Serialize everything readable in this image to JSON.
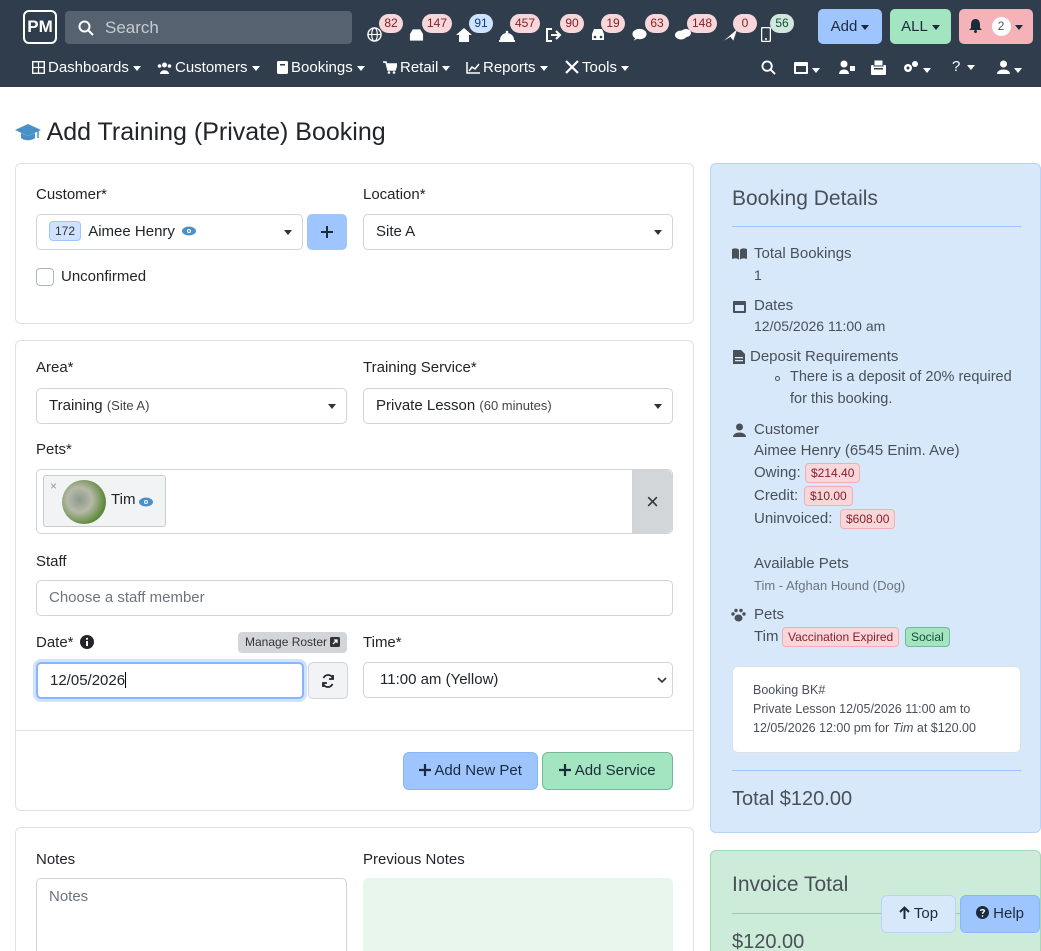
{
  "app": {
    "logo": "PM"
  },
  "search": {
    "placeholder": "Search"
  },
  "counters": [
    {
      "icon": "globe-icon",
      "value": "82",
      "tone": "red"
    },
    {
      "icon": "inbox-icon",
      "value": "147",
      "tone": "red"
    },
    {
      "icon": "home-icon",
      "value": "91",
      "tone": "blue"
    },
    {
      "icon": "bell-service-icon",
      "value": "457",
      "tone": "red"
    },
    {
      "icon": "sign-out-icon",
      "value": "90",
      "tone": "red"
    },
    {
      "icon": "car-icon",
      "value": "19",
      "tone": "red"
    },
    {
      "icon": "chat-icon",
      "value": "63",
      "tone": "red"
    },
    {
      "icon": "comments-icon",
      "value": "148",
      "tone": "red"
    },
    {
      "icon": "plane-icon",
      "value": "0",
      "tone": "red"
    },
    {
      "icon": "mobile-icon",
      "value": "56",
      "tone": "green"
    }
  ],
  "toolbar": {
    "add_label": "Add",
    "all_label": "ALL",
    "notif_count": "2"
  },
  "nav": {
    "dashboards": "Dashboards",
    "customers": "Customers",
    "bookings": "Bookings",
    "retail": "Retail",
    "reports": "Reports",
    "tools": "Tools"
  },
  "page": {
    "title": "Add Training (Private) Booking"
  },
  "form": {
    "customer_label": "Customer*",
    "customer_id": "172",
    "customer_name": "Aimee Henry",
    "location_label": "Location*",
    "location_value": "Site A",
    "unconfirmed_label": "Unconfirmed",
    "area_label": "Area*",
    "area_value": "Training",
    "area_hint": "(Site A)",
    "service_label": "Training Service*",
    "service_value": "Private Lesson",
    "service_hint": "(60 minutes)",
    "pets_label": "Pets*",
    "pet_name": "Tim",
    "pet_remove": "×",
    "pets_clear": "×",
    "staff_label": "Staff",
    "staff_placeholder": "Choose a staff member",
    "date_label": "Date*",
    "manage_roster": "Manage Roster",
    "date_value": "12/05/2026",
    "time_label": "Time*",
    "time_value": "11:00 am (Yellow)",
    "add_pet_label": "Add New Pet",
    "add_service_label": "Add Service",
    "notes_label": "Notes",
    "notes_placeholder": "Notes",
    "prev_notes_label": "Previous Notes"
  },
  "details": {
    "title": "Booking Details",
    "total_bookings_label": "Total Bookings",
    "total_bookings_value": "1",
    "dates_label": "Dates",
    "dates_value": "12/05/2026 11:00 am",
    "deposit_label": "Deposit Requirements",
    "deposit_text_1": "There is a deposit of 20% required",
    "deposit_text_2": "for this booking.",
    "customer_label": "Customer",
    "customer_value": "Aimee Henry (6545 Enim. Ave)",
    "owing_label": "Owing:",
    "owing_value": "$214.40",
    "credit_label": "Credit:",
    "credit_value": "$10.00",
    "uninvoiced_label": "Uninvoiced:",
    "uninvoiced_value": "$608.00",
    "available_pets_label": "Available Pets",
    "available_pets_value": "Tim - Afghan Hound (Dog)",
    "pets_label": "Pets",
    "pet_name": "Tim",
    "vacc_badge": "Vaccination Expired",
    "social_badge": "Social",
    "booking_line_1": "Booking BK#",
    "booking_line_2": "Private Lesson 12/05/2026 11:00 am to",
    "booking_line_3a": "12/05/2026 12:00 pm for ",
    "booking_line_3b": "Tim",
    "booking_line_3c": " at $120.00",
    "total": "Total $120.00"
  },
  "invoice": {
    "title": "Invoice Total",
    "amount": "$120.00"
  },
  "floating": {
    "top_label": "Top",
    "help_label": "Help"
  },
  "colors": {
    "nav_bg": "#2f3d4c",
    "add_btn": "#9ec5fe",
    "all_btn": "#a3e4c1",
    "notif_btn": "#f5b3b9",
    "side_bg": "#d7e8fb",
    "invoice_bg": "#cdebd9"
  }
}
